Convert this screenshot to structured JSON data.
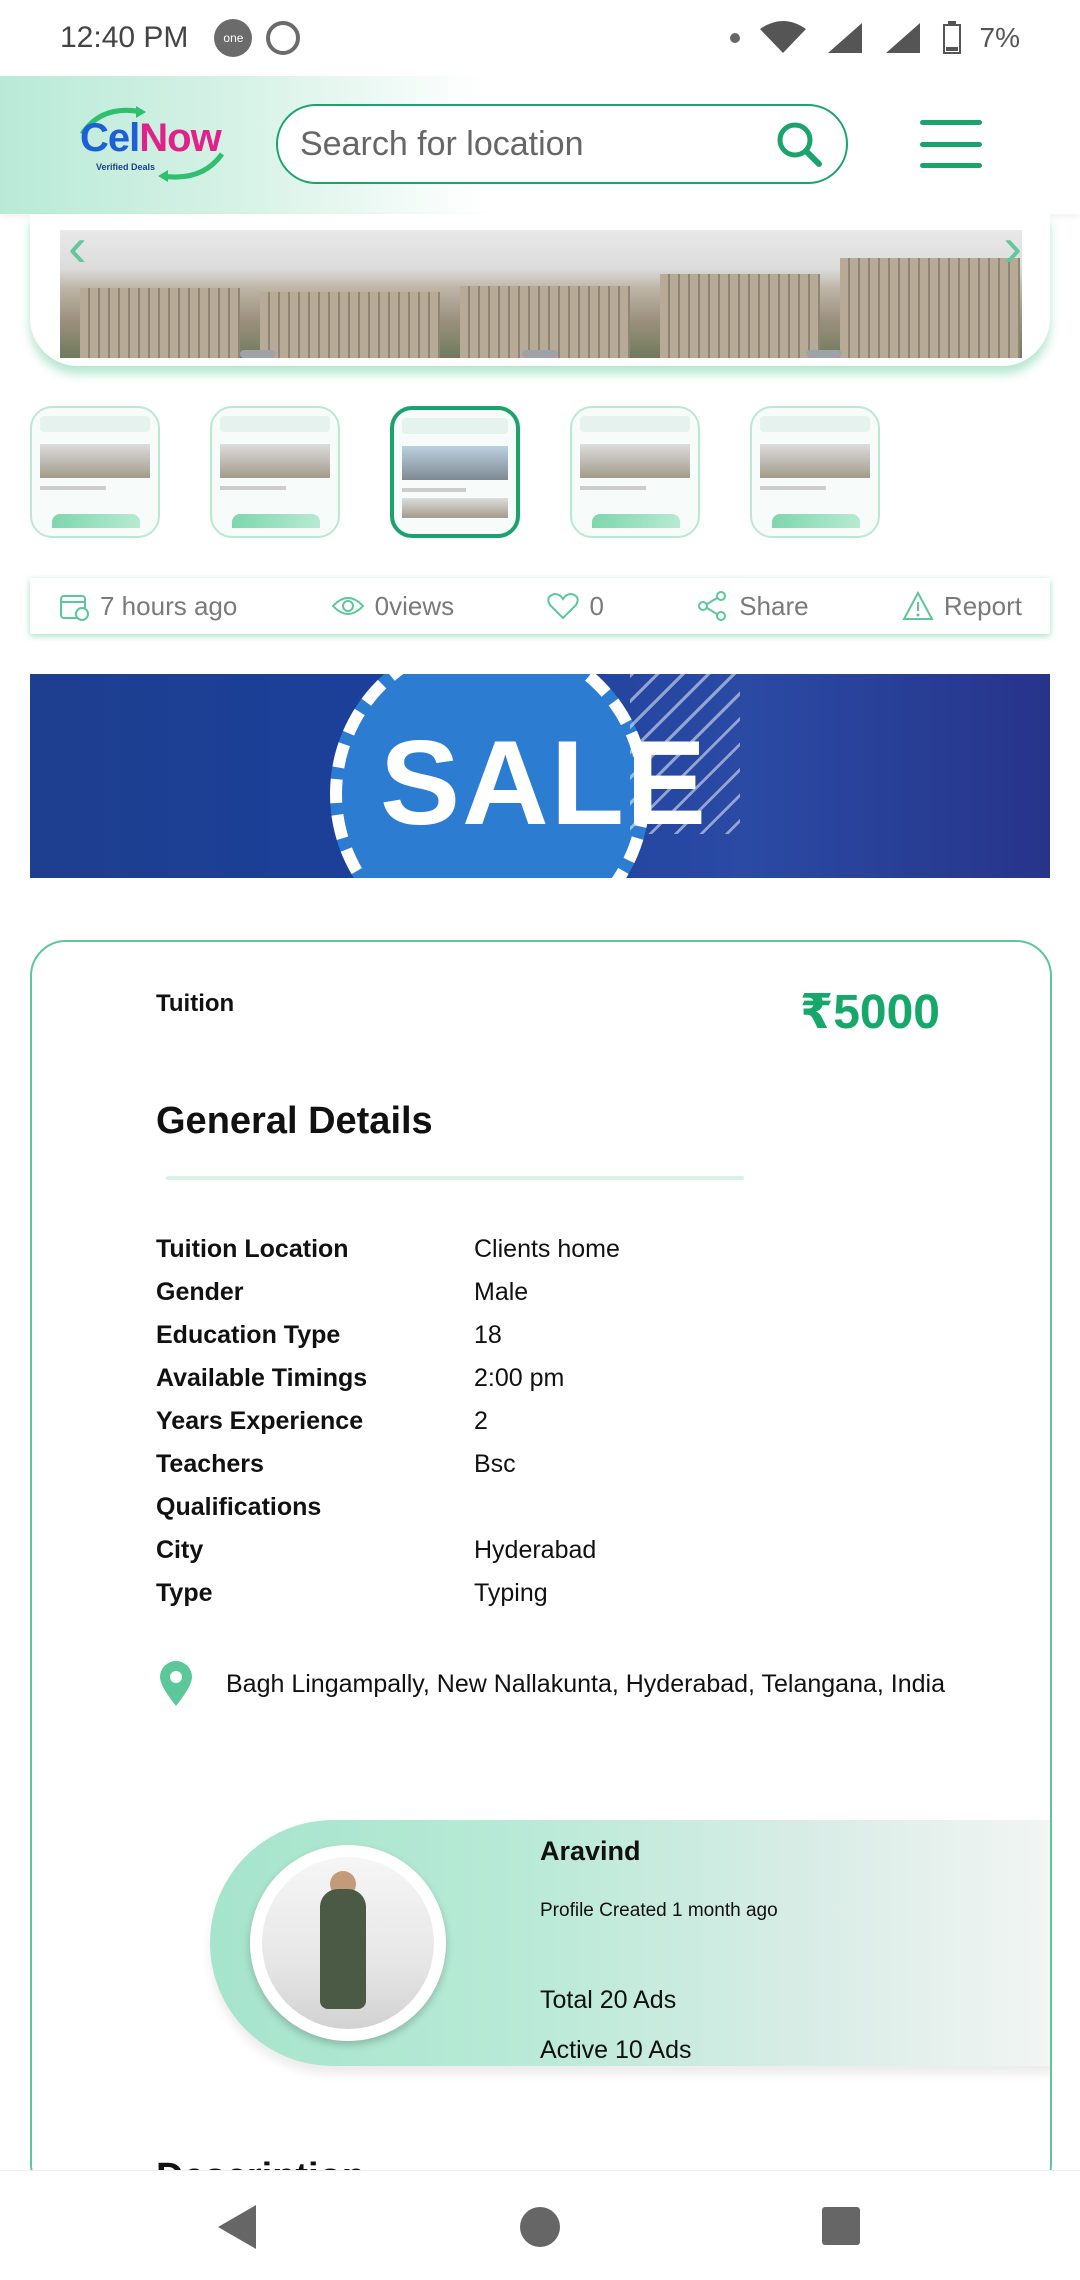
{
  "status_bar": {
    "time": "12:40 PM",
    "app_badge": "one",
    "battery": "7%"
  },
  "header": {
    "logo_brand_first": "Cel",
    "logo_brand_second": "Now",
    "logo_tagline": "Verified Deals",
    "search": {
      "placeholder": "Search for location"
    }
  },
  "listing_meta": {
    "posted": "7 hours ago",
    "views": "0views",
    "likes": "0",
    "share_label": "Share",
    "report_label": "Report"
  },
  "banner": {
    "text": "SALE"
  },
  "details": {
    "category": "Tuition",
    "price": "₹5000",
    "section_title": "General Details",
    "rows": [
      {
        "key": "Tuition Location",
        "value": "Clients home"
      },
      {
        "key": "Gender",
        "value": "Male"
      },
      {
        "key": "Education Type",
        "value": "18"
      },
      {
        "key": "Available Timings",
        "value": "2:00 pm"
      },
      {
        "key": "Years Experience",
        "value": "2"
      },
      {
        "key": "Teachers",
        "value": "Bsc"
      },
      {
        "key": "Qualifications",
        "value": ""
      },
      {
        "key": "City",
        "value": "Hyderabad"
      },
      {
        "key": "Type",
        "value": "Typing"
      }
    ],
    "address": "Bagh Lingampally, New Nallakunta, Hyderabad, Telangana, India"
  },
  "seller": {
    "name": "Aravind",
    "created": "Profile Created 1 month ago",
    "total_ads": "Total 20 Ads",
    "active_ads": "Active 10 Ads"
  },
  "description": {
    "title": "Description"
  },
  "colors": {
    "accent": "#1aa36c",
    "accent_light": "#b8ead3",
    "banner_blue": "#1e3f8f"
  }
}
